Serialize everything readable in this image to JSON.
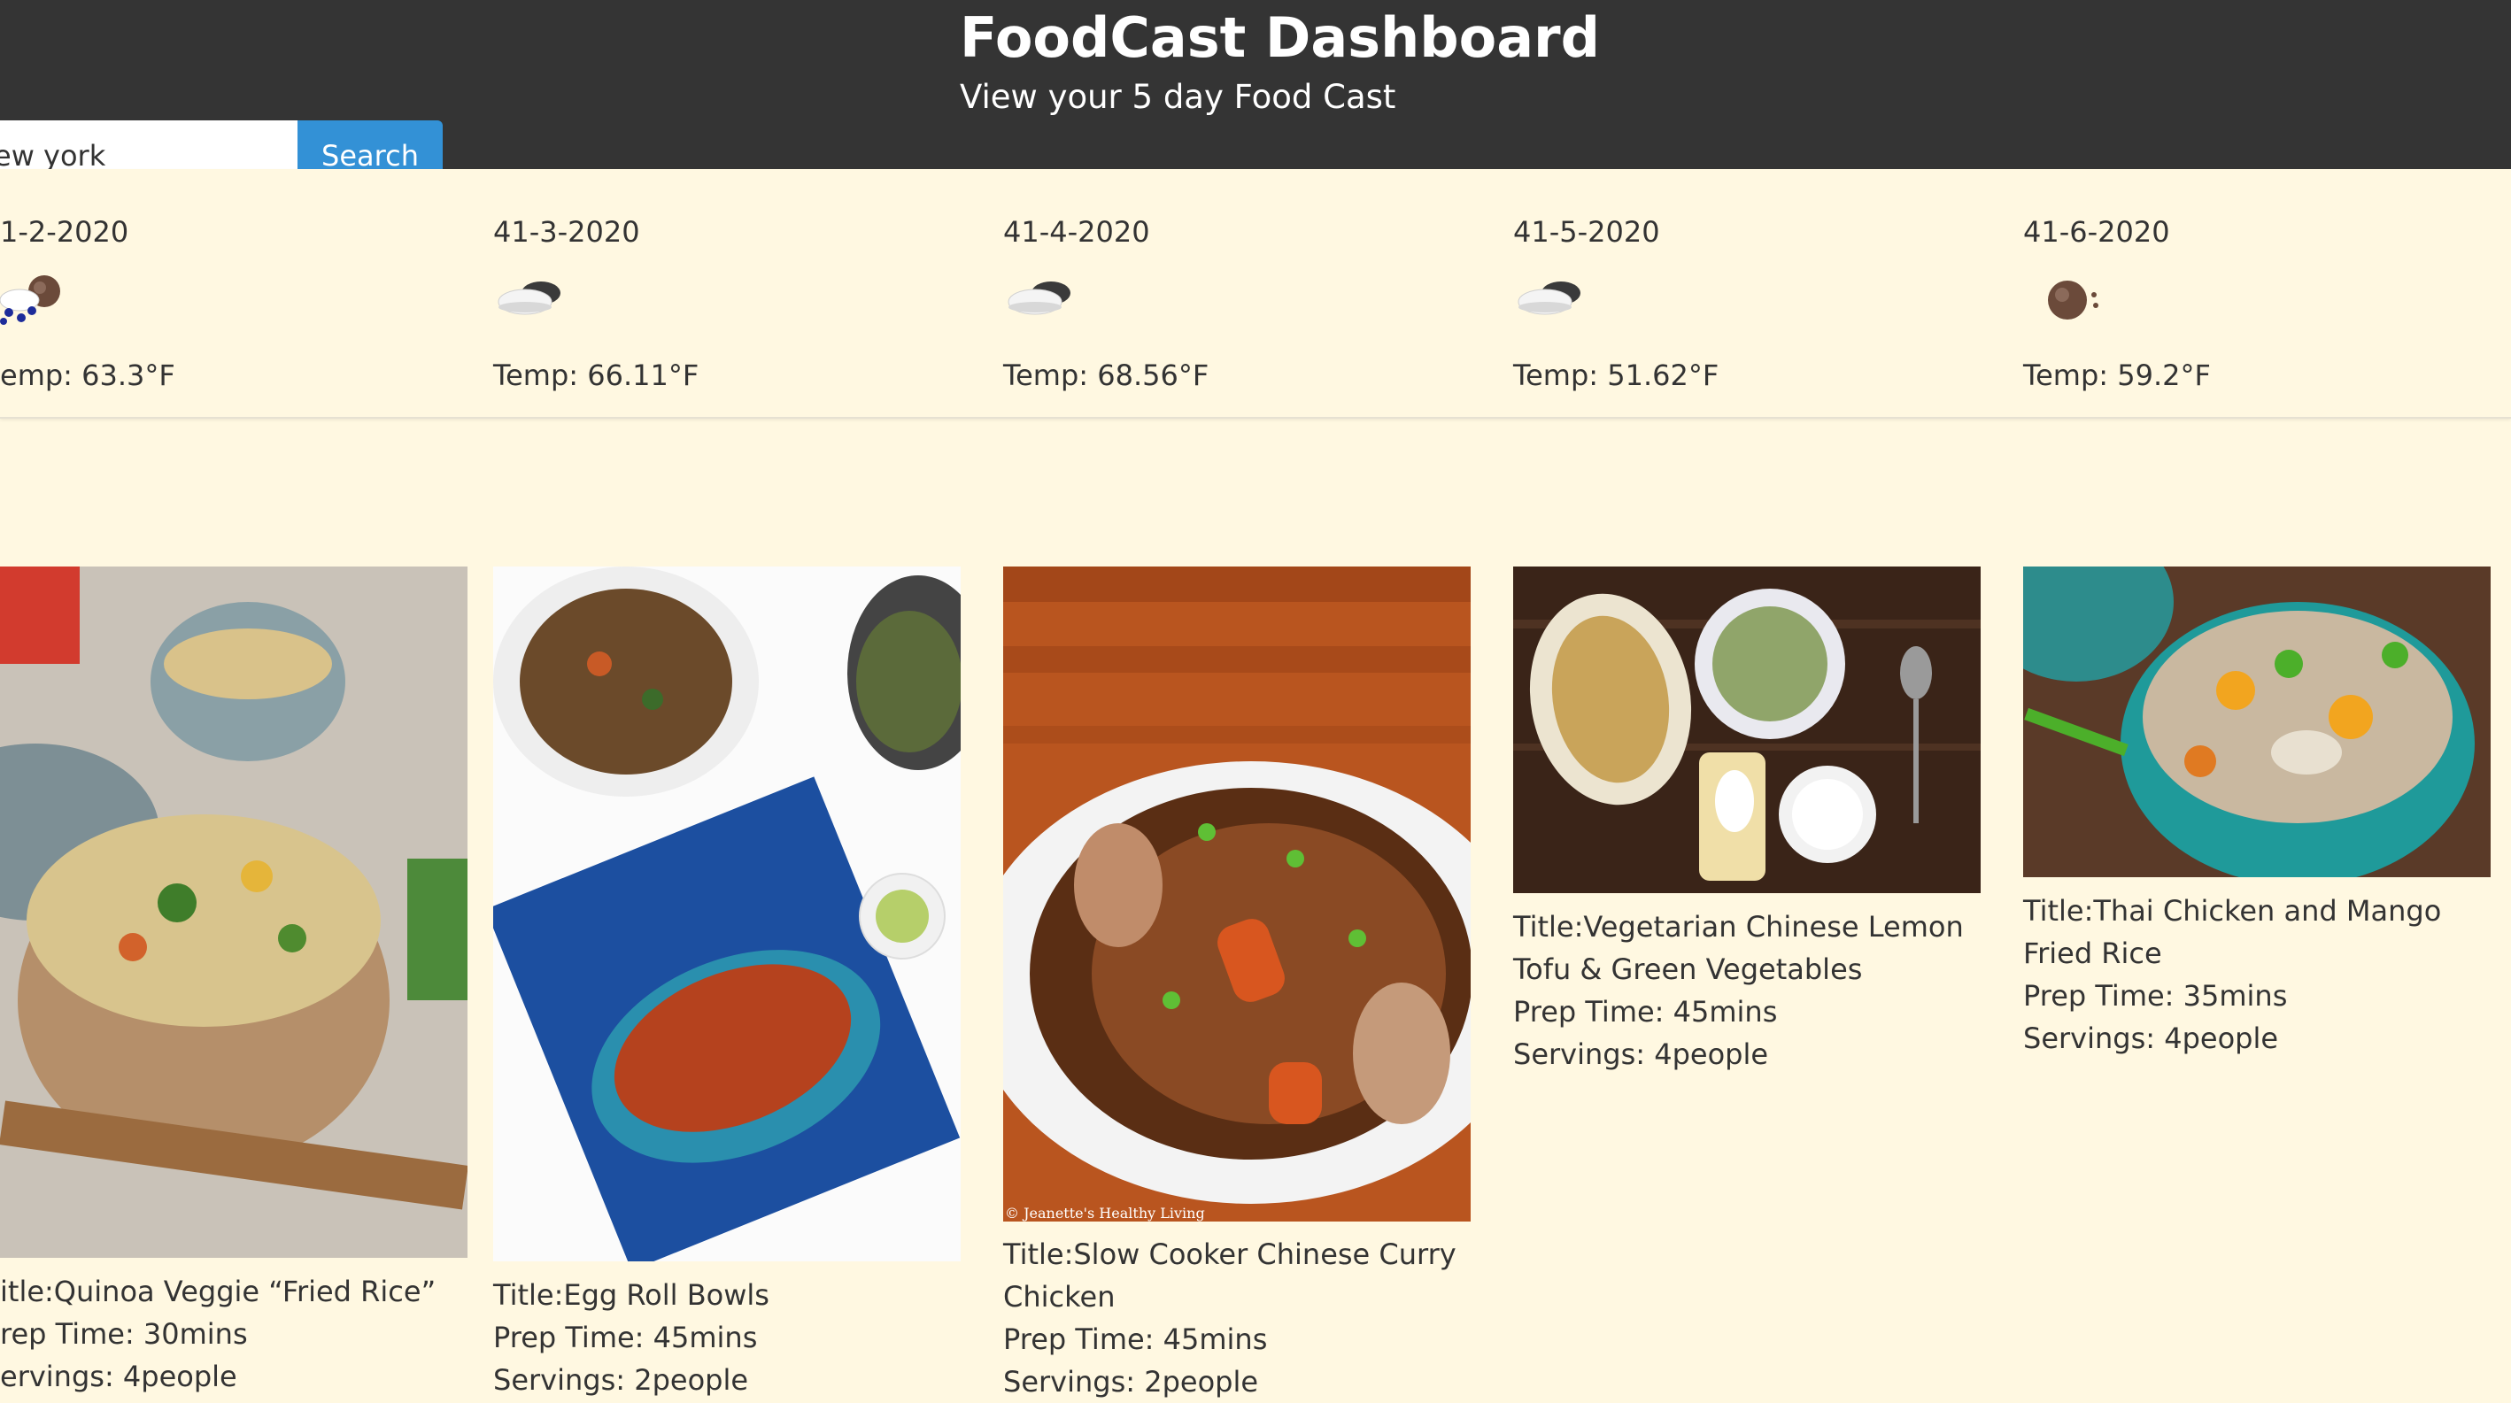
{
  "header": {
    "title": "FoodCast Dashboard",
    "subtitle": "View your 5 day Food Cast"
  },
  "search": {
    "value": "ew york",
    "button_label": "Search"
  },
  "forecast": [
    {
      "date": "1-2-2020",
      "icon": "rain-cloud-icon",
      "temp": "emp: 63.3°F"
    },
    {
      "date": "41-3-2020",
      "icon": "partly-cloudy-icon",
      "temp": "Temp: 66.11°F"
    },
    {
      "date": "41-4-2020",
      "icon": "partly-cloudy-icon",
      "temp": "Temp: 68.56°F"
    },
    {
      "date": "41-5-2020",
      "icon": "partly-cloudy-icon",
      "temp": "Temp: 51.62°F"
    },
    {
      "date": "41-6-2020",
      "icon": "clear-night-icon",
      "temp": "Temp: 59.2°F"
    }
  ],
  "recipes": [
    {
      "title": "itle:Quinoa Veggie “Fried Rice”",
      "prep": "rep Time: 30mins",
      "servings": "ervings: 4people",
      "image": "fried-rice-bowl-photo"
    },
    {
      "title": "Title:Egg Roll Bowls",
      "prep": "Prep Time: 45mins",
      "servings": "Servings: 2people",
      "image": "skinnytaste-cookbook-photo"
    },
    {
      "title": "Title:Slow Cooker Chinese Curry Chicken",
      "prep": "Prep Time: 45mins",
      "servings": "Servings: 2people",
      "image": "curry-chicken-photo",
      "image_credit": "© Jeanette's Healthy Living"
    },
    {
      "title": "Title:Vegetarian Chinese Lemon Tofu & Green Vegetables",
      "prep": "Prep Time: 45mins",
      "servings": "Servings: 4people",
      "image": "tofu-vegetables-photo"
    },
    {
      "title": "Title:Thai Chicken and Mango Fried Rice",
      "prep": "Prep Time: 35mins",
      "servings": "Servings: 4people",
      "image": "mango-fried-rice-photo"
    }
  ],
  "colors": {
    "header_bg": "#343434",
    "page_bg": "#fff8e1",
    "accent": "#3391d6"
  }
}
